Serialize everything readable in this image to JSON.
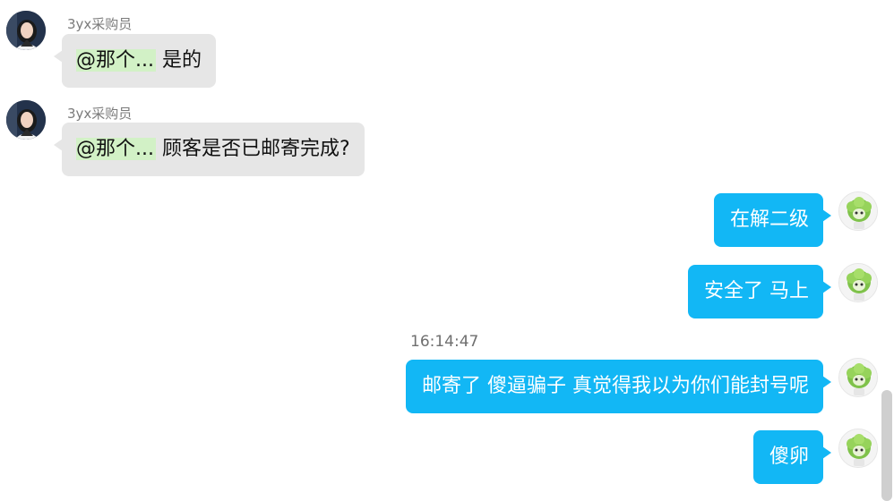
{
  "messages": [
    {
      "side": "left",
      "sender": "3yx采购员",
      "mention": "@那个...",
      "text": "是的",
      "avatar_icon": "person-avatar-icon"
    },
    {
      "side": "left",
      "sender": "3yx采购员",
      "mention": "@那个...",
      "text": "顾客是否已邮寄完成?",
      "avatar_icon": "person-avatar-icon"
    },
    {
      "side": "right",
      "text": "在解二级",
      "avatar_icon": "cabbage-avatar-icon"
    },
    {
      "side": "right",
      "text": "安全了 马上",
      "avatar_icon": "cabbage-avatar-icon"
    },
    {
      "side": "right",
      "timestamp": "16:14:47",
      "text": "邮寄了 傻逼骗子  真觉得我以为你们能封号呢",
      "avatar_icon": "cabbage-avatar-icon"
    },
    {
      "side": "right",
      "text": "傻卵",
      "avatar_icon": "cabbage-avatar-icon"
    }
  ],
  "colors": {
    "incoming_bubble": "#e6e6e6",
    "outgoing_bubble": "#12b7f5",
    "mention_highlight": "#d2f1c6",
    "sender_text": "#7b7b7b"
  }
}
